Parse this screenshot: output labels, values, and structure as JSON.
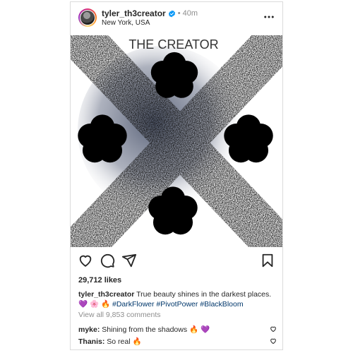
{
  "post": {
    "username": "tyler_th3creator",
    "separator": "•",
    "time": "40m",
    "location": "New York, USA"
  },
  "media": {
    "title_text": "THE CREATOR"
  },
  "engagement": {
    "likes": "29,712 likes"
  },
  "caption": {
    "username": "tyler_th3creator",
    "text": "True beauty shines in the darkest places.",
    "emoji": "💜 🌸 🔥",
    "hashtags": [
      "#DarkFlower",
      "#PivotPower",
      "#BlackBloom"
    ]
  },
  "comments_summary": "View all 9,853 comments",
  "comments": [
    {
      "username": "myke:",
      "text": "Shining from the shadows 🔥 💜"
    },
    {
      "username": "Thanis:",
      "text": "So real 🔥"
    }
  ],
  "icons": {
    "verified": "verified-badge-icon",
    "more": "more-options-icon",
    "like": "heart-icon",
    "comment": "comment-bubble-icon",
    "share": "paper-plane-icon",
    "save": "bookmark-icon"
  },
  "colors": {
    "verified_blue": "#0095f6",
    "hashtag_blue": "#00376b",
    "muted_text": "#8e8e8e"
  }
}
